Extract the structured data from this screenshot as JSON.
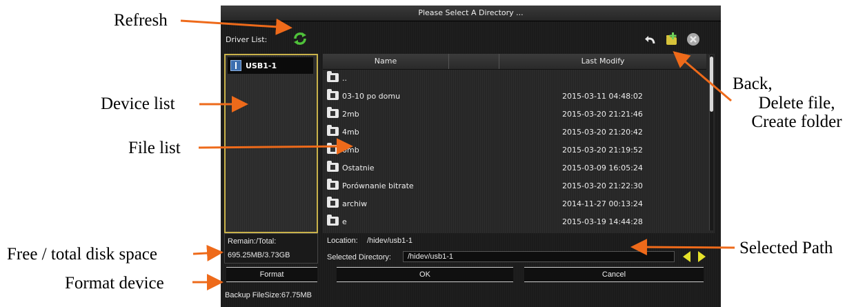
{
  "annotations": {
    "refresh": "Refresh",
    "device_list": "Device list",
    "file_list": "File list",
    "free_total": "Free / total disk space",
    "format_device": "Format device",
    "back_line1": "Back,",
    "back_line2": "Delete file,",
    "back_line3": "Create folder",
    "selected_path": "Selected Path"
  },
  "dialog": {
    "title": "Please Select A Directory ...",
    "driver_list_label": "Driver List:",
    "devices": [
      {
        "name": "USB1-1"
      }
    ],
    "columns": {
      "name": "Name",
      "last_modify": "Last Modify"
    },
    "files": [
      {
        "name": "..",
        "date": ""
      },
      {
        "name": "03-10 po domu",
        "date": "2015-03-11 04:48:02"
      },
      {
        "name": "2mb",
        "date": "2015-03-20 21:21:46"
      },
      {
        "name": "4mb",
        "date": "2015-03-20 21:20:42"
      },
      {
        "name": "6mb",
        "date": "2015-03-20 21:19:52"
      },
      {
        "name": "Ostatnie",
        "date": "2015-03-09 16:05:24"
      },
      {
        "name": "Porównanie bitrate",
        "date": "2015-03-20 21:22:30"
      },
      {
        "name": "archiw",
        "date": "2014-11-27 00:13:24"
      },
      {
        "name": "e",
        "date": "2015-03-19 14:44:28"
      }
    ],
    "remain_label": "Remain:/Total:",
    "remain_value": "695.25MB/3.73GB",
    "location_label": "Location:",
    "location_value": "/hidev/usb1-1",
    "selected_dir_label": "Selected Directory:",
    "selected_dir_value": "/hidev/usb1-1",
    "format_button": "Format",
    "ok_button": "OK",
    "cancel_button": "Cancel",
    "backup_size": "Backup FileSize:67.75MB"
  },
  "colors": {
    "arrow": "#ee6a1a",
    "device_list_border": "#c9b24a",
    "refresh_icon": "#4fc23a",
    "nav_arrow": "#e6e22a"
  },
  "icons": [
    "refresh-icon",
    "back-icon",
    "new-folder-icon",
    "delete-icon",
    "usb-icon",
    "folder-icon",
    "arrow-left-icon",
    "arrow-right-icon"
  ]
}
